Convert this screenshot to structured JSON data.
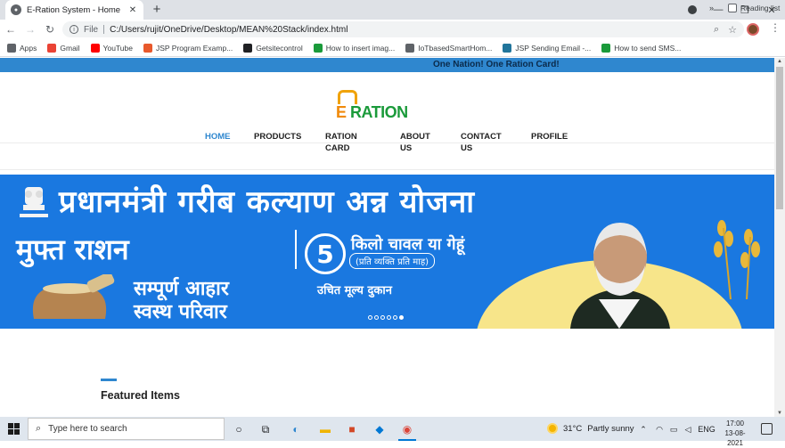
{
  "browser": {
    "tab_title": "E-Ration System - Home",
    "url_scheme": "File",
    "url": "C:/Users/rujit/OneDrive/Desktop/MEAN%20Stack/index.html",
    "bookmarks": [
      {
        "label": "Apps",
        "icon": "apps-grid-icon",
        "color": "#5f6368"
      },
      {
        "label": "Gmail",
        "icon": "gmail-icon",
        "color": "#ea4335"
      },
      {
        "label": "YouTube",
        "icon": "youtube-icon",
        "color": "#ff0000"
      },
      {
        "label": "JSP Program Examp...",
        "icon": "jsp-icon",
        "color": "#e8592c"
      },
      {
        "label": "Getsitecontrol",
        "icon": "getsitecontrol-icon",
        "color": "#202124"
      },
      {
        "label": "How to insert imag...",
        "icon": "s-bookmark-icon",
        "color": "#1a9a3a"
      },
      {
        "label": "IoTbasedSmartHom...",
        "icon": "globe-icon",
        "color": "#5f6368"
      },
      {
        "label": "JSP Sending Email -...",
        "icon": "wordpress-icon",
        "color": "#21759b"
      },
      {
        "label": "How to send SMS...",
        "icon": "s-bookmark-icon",
        "color": "#1a9a3a"
      }
    ],
    "reading_list": "Reading list",
    "more": "»"
  },
  "site": {
    "banner_text": "One Nation! One Ration Card!",
    "logo_text_e": "E",
    "logo_text_rest": " RATION",
    "nav": [
      {
        "label": "HOME",
        "active": true
      },
      {
        "label": "PRODUCTS",
        "active": false
      },
      {
        "label": "RATION CARD",
        "line1": "RATION",
        "line2": "CARD",
        "active": false
      },
      {
        "label": "ABOUT US",
        "line1": "ABOUT",
        "line2": "US",
        "active": false
      },
      {
        "label": "CONTACT US",
        "line1": "CONTACT",
        "line2": "US",
        "active": false
      },
      {
        "label": "PROFILE",
        "active": false
      }
    ],
    "hero": {
      "title": "प्रधानमंत्री गरीब कल्याण अन्न योजना",
      "free_ration": "मुफ्त राशन",
      "number": "5",
      "kilo": "किलो चावल या गेहूं",
      "per_person": "(प्रति व्यक्ति प्रति माह)",
      "wholesome_line1": "सम्पूर्ण आहार",
      "wholesome_line2": "स्वस्थ परिवार",
      "fair_price": "उचित मूल्य दुकान",
      "slides": 6,
      "active_slide": 6,
      "bg_color": "#1a78e0"
    },
    "featured_title": "Featured Items",
    "accent_color": "#2f87cf"
  },
  "taskbar": {
    "search_placeholder": "Type here to search",
    "weather_temp": "31°C",
    "weather_text": "Partly sunny",
    "language": "ENG",
    "time": "17:00",
    "date": "13-08-2021"
  }
}
